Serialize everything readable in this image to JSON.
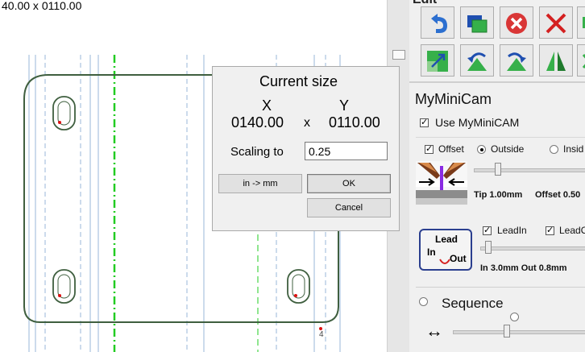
{
  "canvas": {
    "size_readout": "40.00 x  0110.00",
    "point_label": "4"
  },
  "dialog": {
    "title": "Current size",
    "x_label": "X",
    "y_label": "Y",
    "x_value": "0140.00",
    "times_sign": "x",
    "y_value": "0110.00",
    "scaling_label": "Scaling to",
    "scaling_value": "0.25",
    "in_mm_button": "in -> mm",
    "ok_button": "OK",
    "cancel_button": "Cancel"
  },
  "panel": {
    "edit_title": "Edit",
    "tools": [
      "undo-icon",
      "layers-icon",
      "delete-icon",
      "cut-icon",
      "copy-icon",
      "scale-icon",
      "rotate-left-icon",
      "rotate-right-icon",
      "mirror-icon",
      "shift-icon"
    ],
    "minicam": {
      "title": "MyMiniCam",
      "use_label": "Use MyMiniCAM",
      "use_checked": true,
      "offset_label": "Offset",
      "offset_checked": true,
      "outside_label": "Outside",
      "outside_selected": true,
      "inside_label": "Insid",
      "inside_selected": false,
      "tip_text": "Tip 1.00mm",
      "offset_text": "Offset 0.50",
      "offset_slider": 0.2
    },
    "lead": {
      "icon_lead": "Lead",
      "icon_in": "In",
      "icon_out": "Out",
      "leadin_label": "LeadIn",
      "leadin_checked": true,
      "leadout_label": "LeadO",
      "leadout_checked": true,
      "lead_text": "In 3.0mm Out 0.8mm",
      "lead_slider": 0.05
    },
    "sequence": {
      "title": "Sequence",
      "arrow_icon": "↔",
      "slider": 0.4
    }
  },
  "colors": {
    "guide_green": "#22cc22",
    "guide_blue": "#8fb3d9",
    "outline": "#3f5f3f",
    "marker_red": "#dd1111"
  }
}
